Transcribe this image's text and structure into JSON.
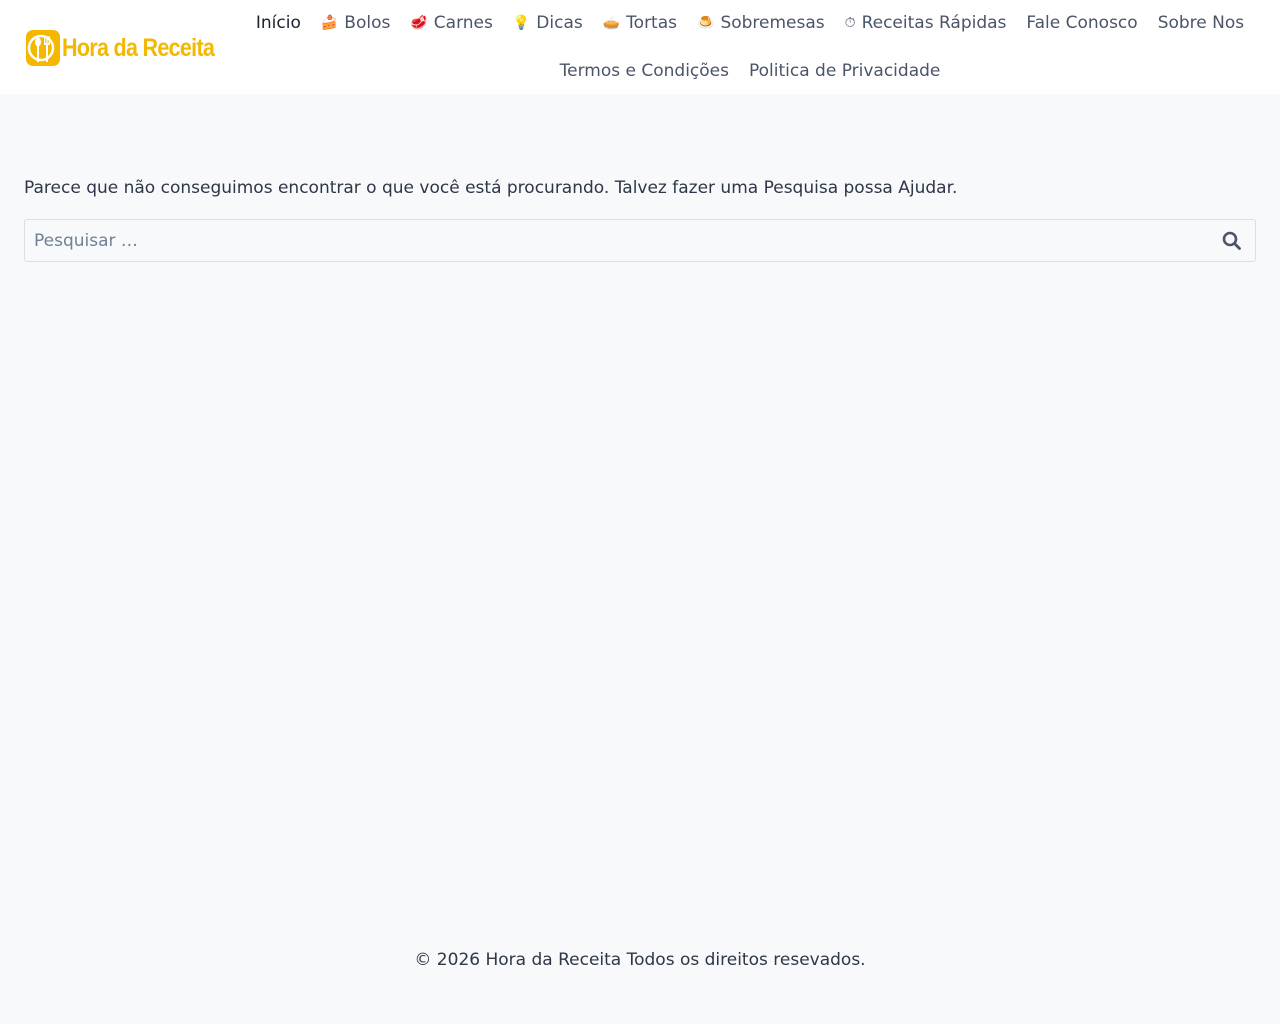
{
  "header": {
    "logo_text": "Hora da Receita",
    "brand_color": "#f5b800",
    "nav_row1": [
      {
        "label": "Início",
        "emoji": "",
        "active": true
      },
      {
        "label": "Bolos",
        "emoji": "🍰"
      },
      {
        "label": "Carnes",
        "emoji": "🥩"
      },
      {
        "label": "Dicas",
        "emoji": "💡"
      },
      {
        "label": "Tortas",
        "emoji": "🥧"
      },
      {
        "label": "Sobremesas",
        "emoji": "🍮"
      },
      {
        "label": "Receitas Rápidas",
        "emoji": "⏱"
      },
      {
        "label": "Fale Conosco",
        "emoji": ""
      },
      {
        "label": "Sobre Nos",
        "emoji": ""
      }
    ],
    "nav_row2": [
      {
        "label": "Termos e Condições",
        "emoji": ""
      },
      {
        "label": "Politica de Privacidade",
        "emoji": ""
      }
    ]
  },
  "main": {
    "message": "Parece que não conseguimos encontrar o que você está procurando. Talvez fazer uma Pesquisa possa Ajudar.",
    "search": {
      "placeholder": "Pesquisar …",
      "value": "",
      "icon": "search-icon"
    }
  },
  "footer": {
    "text": "© 2026 Hora da Receita Todos os direitos resevados."
  }
}
